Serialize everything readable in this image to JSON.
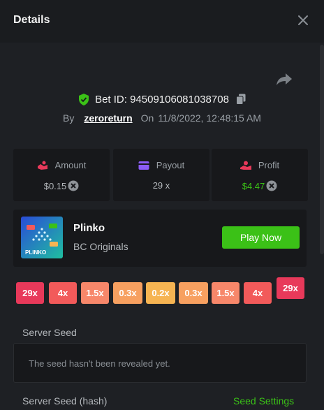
{
  "header": {
    "title": "Details"
  },
  "bet": {
    "id_text": "Bet ID: 94509106081038708",
    "by_label": "By",
    "user": "zeroreturn",
    "on_label": "On",
    "date": "11/8/2022, 12:48:15 AM"
  },
  "stats": [
    {
      "label": "Amount",
      "value": "$0.15",
      "value_color": "#b4b8bc",
      "icon": "hand-coin-icon"
    },
    {
      "label": "Payout",
      "value": "29 x",
      "value_color": "#b4b8bc",
      "icon": "wallet-icon"
    },
    {
      "label": "Profit",
      "value": "$4.47",
      "value_color": "#3bc117",
      "icon": "profit-hand-icon"
    }
  ],
  "game": {
    "name": "Plinko",
    "provider": "BC Originals",
    "play_label": "Play Now",
    "thumb_text": "PLINKO"
  },
  "multipliers": [
    {
      "label": "29x",
      "color": "#e8395a"
    },
    {
      "label": "4x",
      "color": "#f25a5a"
    },
    {
      "label": "1.5x",
      "color": "#f7876a"
    },
    {
      "label": "0.3x",
      "color": "#f7a060"
    },
    {
      "label": "0.2x",
      "color": "#f6b452"
    },
    {
      "label": "0.3x",
      "color": "#f7a060"
    },
    {
      "label": "1.5x",
      "color": "#f7876a"
    },
    {
      "label": "4x",
      "color": "#f25a5a"
    },
    {
      "label": "29x",
      "color": "#e8395a",
      "hit": true
    }
  ],
  "seeds": {
    "server_seed_label": "Server Seed",
    "server_seed_message": "The seed hasn't been revealed yet.",
    "server_seed_hash_label": "Server Seed (hash)",
    "seed_settings_label": "Seed Settings"
  },
  "colors": {
    "accent": "#3bc117",
    "background": "#1e2024",
    "panel": "#17181b"
  }
}
